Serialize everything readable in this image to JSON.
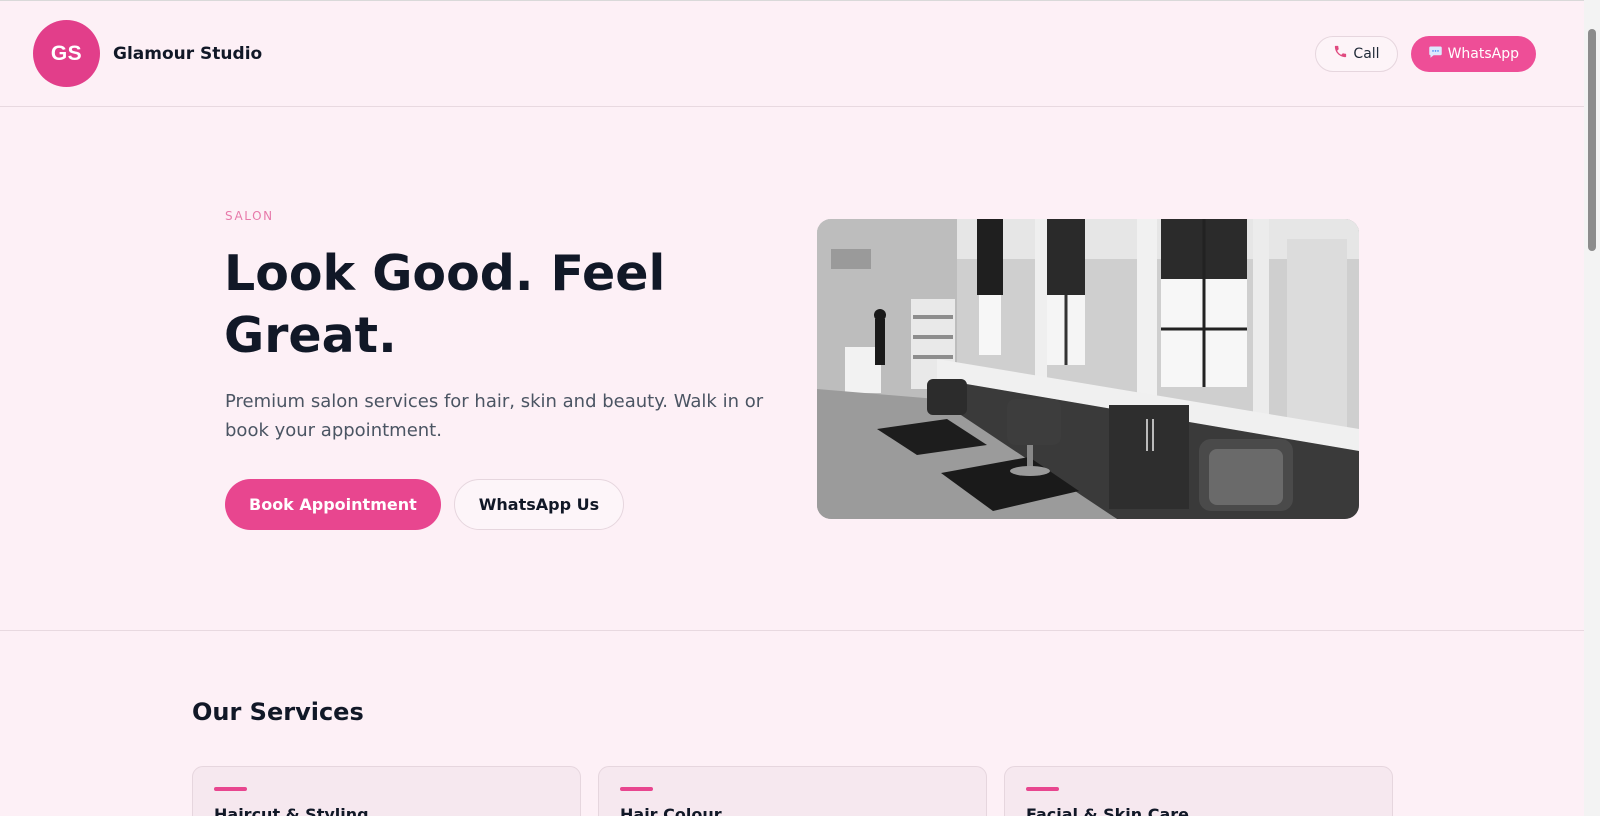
{
  "brand": {
    "initials": "GS",
    "name": "Glamour Studio"
  },
  "header": {
    "call_label": "Call",
    "whatsapp_label": "WhatsApp"
  },
  "hero": {
    "eyebrow": "SALON",
    "title": "Look Good. Feel Great.",
    "subtitle": "Premium salon services for hair, skin and beauty. Walk in or book your appointment.",
    "primary_cta": "Book Appointment",
    "secondary_cta": "WhatsApp Us"
  },
  "services": {
    "title": "Our Services",
    "items": [
      {
        "label": "Haircut & Styling"
      },
      {
        "label": "Hair Colour"
      },
      {
        "label": "Facial & Skin Care"
      }
    ]
  },
  "icons": {
    "call": "phone-icon",
    "whatsapp": "chat-bubble-icon"
  },
  "colors": {
    "accent": "#e8468f",
    "background": "#fdf0f6",
    "text": "#111827"
  }
}
